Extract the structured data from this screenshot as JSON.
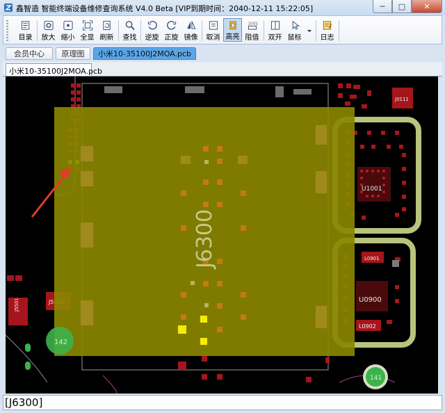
{
  "window": {
    "title": "鑫智造 智能终端设备维修查询系统 V4.0 Beta [VIP到期时间：2040-12-11 15:22:05]",
    "buttons": {
      "minimize": "─",
      "maximize": "□",
      "close": "✕"
    }
  },
  "toolbar": {
    "items": [
      {
        "label": "目录",
        "icon": "catalog-icon"
      },
      {
        "label": "放大",
        "icon": "zoom-in-icon"
      },
      {
        "label": "缩小",
        "icon": "zoom-out-icon"
      },
      {
        "label": "全显",
        "icon": "fit-all-icon"
      },
      {
        "label": "刷新",
        "icon": "refresh-icon"
      },
      {
        "label": "查找",
        "icon": "search-icon"
      },
      {
        "label": "逆旋",
        "icon": "rotate-ccw-icon"
      },
      {
        "label": "正旋",
        "icon": "rotate-cw-icon"
      },
      {
        "label": "镜像",
        "icon": "mirror-icon"
      },
      {
        "label": "取消",
        "icon": "cancel-icon"
      },
      {
        "label": "高亮",
        "icon": "highlight-icon",
        "active": true
      },
      {
        "label": "阻值",
        "icon": "resistance-icon"
      },
      {
        "label": "双开",
        "icon": "dual-view-icon"
      },
      {
        "label": "鼠标",
        "icon": "mouse-icon"
      },
      {
        "label": "日志",
        "icon": "log-icon"
      }
    ]
  },
  "nav_tabs": [
    {
      "label": "会员中心"
    },
    {
      "label": "原理图"
    },
    {
      "label": "小米10-35100J2MOA.pcb",
      "active": true
    }
  ],
  "doc_tab": {
    "label": "小米10-35100J2MOA.pcb"
  },
  "pcb": {
    "highlighted_component": "J6300",
    "labels": {
      "j0111": "J0111",
      "u1001": "U1001",
      "l0901": "L0901",
      "u0900": "U0900",
      "l0902": "L0902",
      "j5501": "J5501",
      "j5502": "J5502",
      "tp142": "142",
      "tp141": "141"
    },
    "colors": {
      "highlight": "#8a8500",
      "pad_orange": "#c47a12",
      "pad_red": "#a5161c",
      "pad_yellow": "#f2ee00",
      "shield": "#b7c47c",
      "test_point": "#3cb34a",
      "arrow": "#e23a2a"
    }
  },
  "status": {
    "text": "[J6300]"
  }
}
